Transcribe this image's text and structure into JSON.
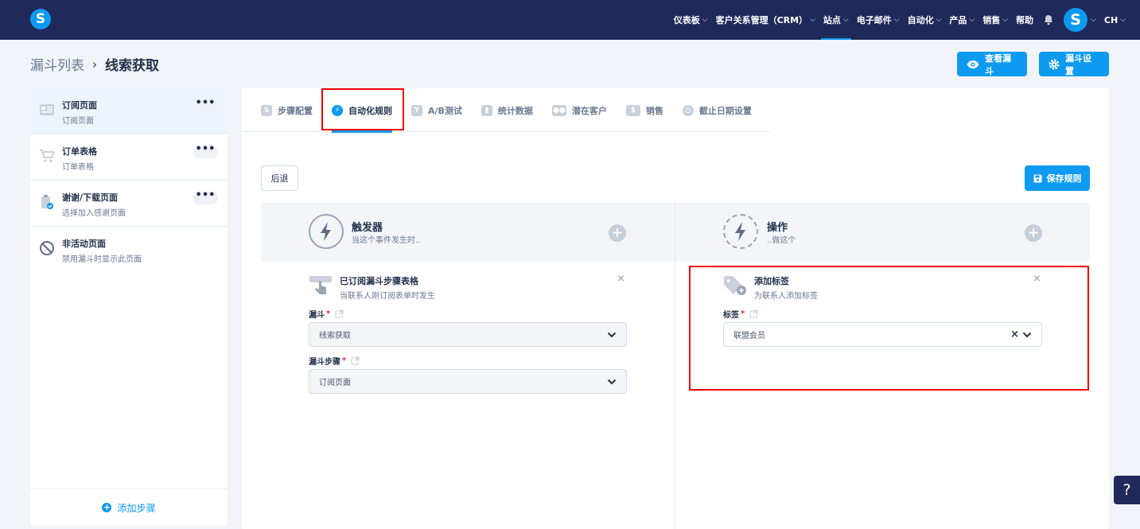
{
  "nav": {
    "logo": "S",
    "items": [
      {
        "label": "仪表板"
      },
      {
        "label": "客户关系管理（CRM）"
      },
      {
        "label": "站点"
      },
      {
        "label": "电子邮件"
      },
      {
        "label": "自动化"
      },
      {
        "label": "产品"
      },
      {
        "label": "销售"
      }
    ],
    "help": "帮助",
    "avatar": "S",
    "lang": "CH"
  },
  "breadcrumb": {
    "parent": "漏斗列表",
    "current": "线索获取"
  },
  "header_buttons": {
    "view": "查看漏斗",
    "settings": "漏斗设置"
  },
  "sidebar": {
    "steps": [
      {
        "title": "订阅页面",
        "subtitle": "订阅页面"
      },
      {
        "title": "订单表格",
        "subtitle": "订单表格"
      },
      {
        "title": "谢谢/下载页面",
        "subtitle": "选择加入感谢页面"
      },
      {
        "title": "非活动页面",
        "subtitle": "禁用漏斗时显示此页面"
      }
    ],
    "more": "•••",
    "add_step": "添加步骤"
  },
  "tabs": [
    {
      "label": "步骤配置"
    },
    {
      "label": "自动化规则"
    },
    {
      "label": "A/B测试"
    },
    {
      "label": "统计数据"
    },
    {
      "label": "潜在客户"
    },
    {
      "label": "销售"
    },
    {
      "label": "截止日期设置"
    }
  ],
  "toolbar": {
    "back": "后退",
    "save": "保存规则"
  },
  "trigger": {
    "title": "触发器",
    "subtitle": "当这个事件发生时..",
    "card_title": "已订阅漏斗步骤表格",
    "card_sub": "当联系人刚订阅表单时发生",
    "field1_label": "漏斗",
    "field1_value": "线索获取",
    "field2_label": "漏斗步骤",
    "field2_value": "订阅页面"
  },
  "action": {
    "title": "操作",
    "subtitle": "..做这个",
    "card_title": "添加标签",
    "card_sub": "为联系人添加标签",
    "field_label": "标签",
    "field_value": "联盟会员"
  },
  "help_label": "?",
  "colors": {
    "navy": "#1f2a5a",
    "accent": "#0e9af0",
    "highlight": "#ee0000"
  }
}
